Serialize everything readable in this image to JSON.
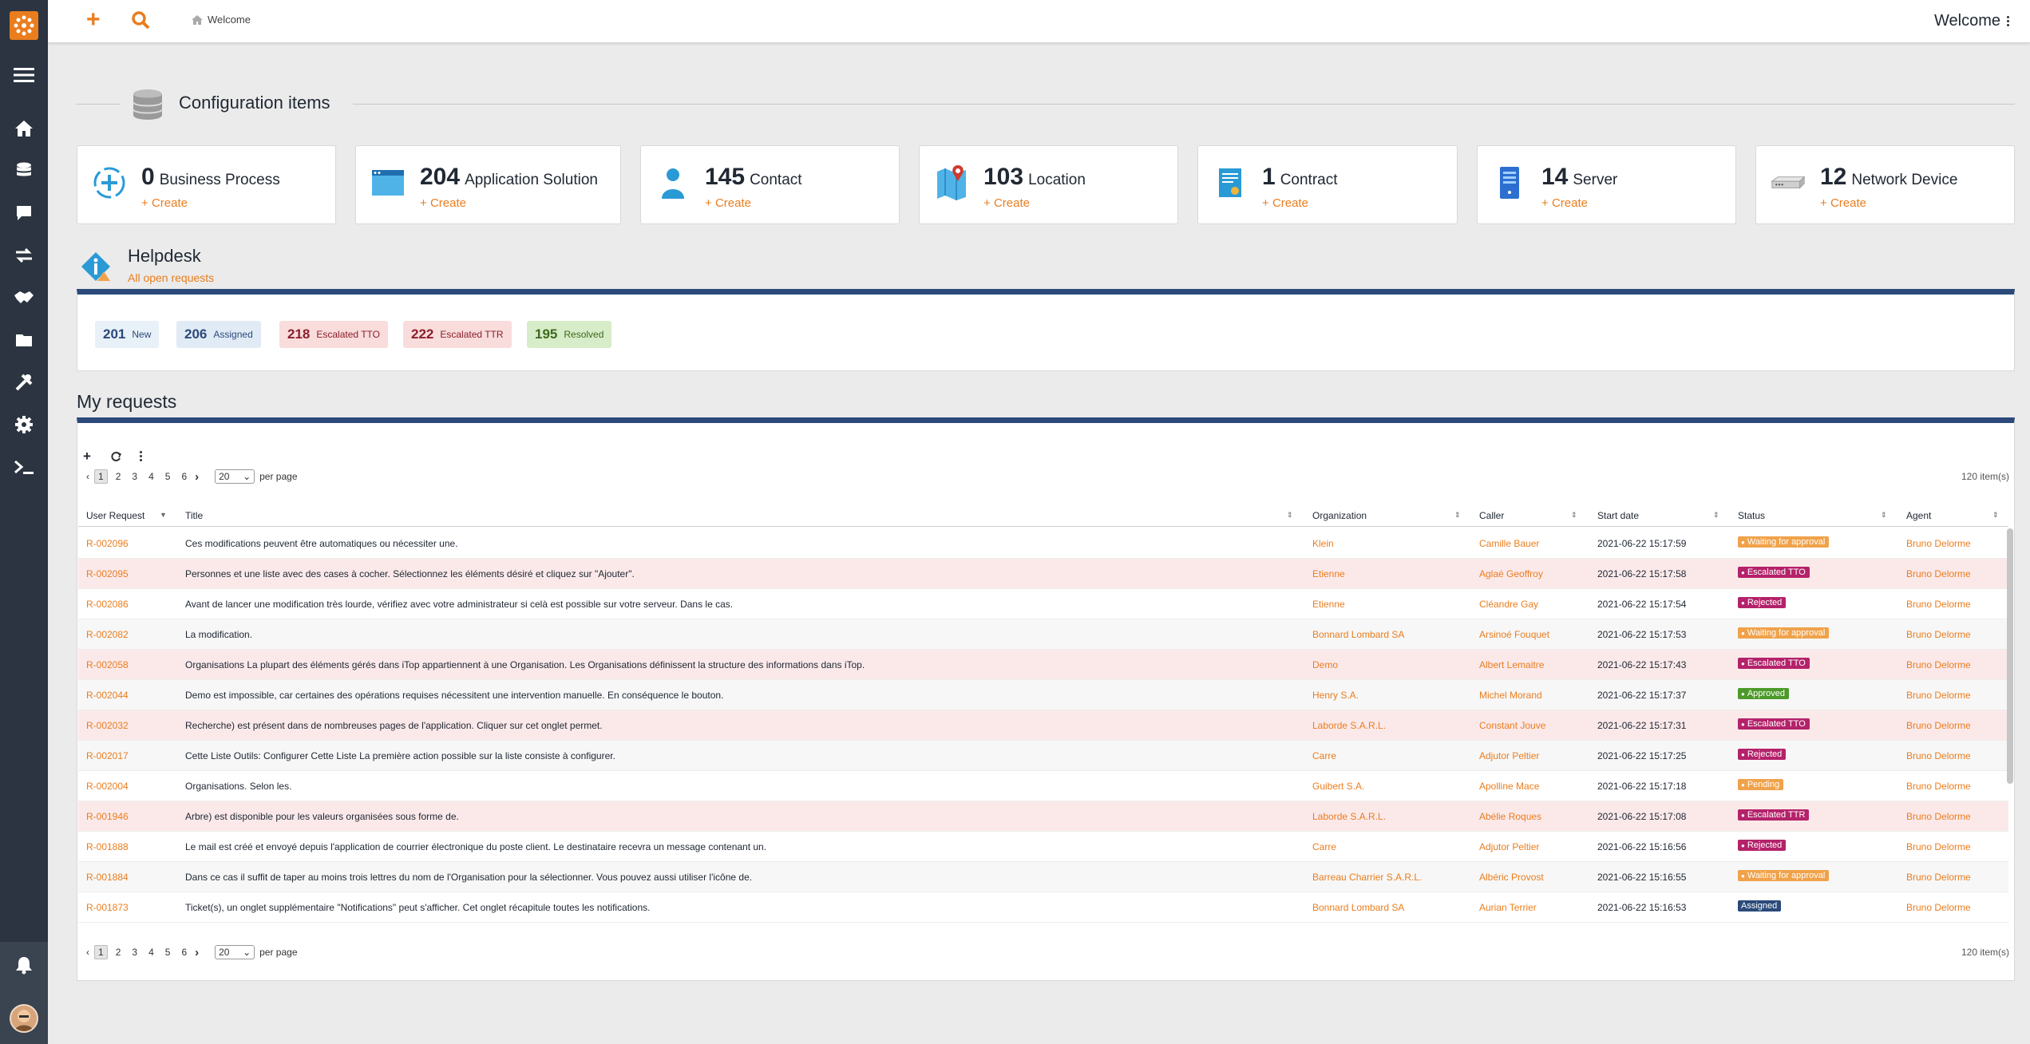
{
  "topbar": {
    "breadcrumb": "Welcome",
    "user_menu": "Welcome"
  },
  "section": {
    "title": "Configuration items"
  },
  "dashlets": [
    {
      "count": "0",
      "label": "Business Process",
      "create": "Create",
      "icon": "business-process-icon"
    },
    {
      "count": "204",
      "label": "Application Solution",
      "create": "Create",
      "icon": "application-solution-icon"
    },
    {
      "count": "145",
      "label": "Contact",
      "create": "Create",
      "icon": "contact-icon"
    },
    {
      "count": "103",
      "label": "Location",
      "create": "Create",
      "icon": "location-icon"
    },
    {
      "count": "1",
      "label": "Contract",
      "create": "Create",
      "icon": "contract-icon"
    },
    {
      "count": "14",
      "label": "Server",
      "create": "Create",
      "icon": "server-icon"
    },
    {
      "count": "12",
      "label": "Network Device",
      "create": "Create",
      "icon": "network-device-icon"
    }
  ],
  "helpdesk": {
    "title": "Helpdesk",
    "subtitle": "All open requests",
    "badges": [
      {
        "count": "201",
        "label": "New",
        "color": "#e8f0f8"
      },
      {
        "count": "206",
        "label": "Assigned",
        "color": "#e1ebf5"
      },
      {
        "count": "218",
        "label": "Escalated TTO",
        "color": "#f9dcdc"
      },
      {
        "count": "222",
        "label": "Escalated TTR",
        "color": "#f9dcdc"
      },
      {
        "count": "195",
        "label": "Resolved",
        "color": "#d7ecc8"
      }
    ]
  },
  "my_requests": {
    "title": "My requests",
    "pages": [
      "1",
      "2",
      "3",
      "4",
      "5",
      "6"
    ],
    "per_page_value": "20",
    "per_page_label": "per page",
    "item_count": "120 item(s)",
    "columns": [
      "User Request",
      "Title",
      "Organization",
      "Caller",
      "Start date",
      "Status",
      "Agent"
    ],
    "rows": [
      {
        "ref": "R-002096",
        "title": "Ces modifications peuvent être automatiques ou nécessiter une.",
        "org": "Klein",
        "caller": "Camille Bauer",
        "date": "2021-06-22 15:17:59",
        "status": "Waiting for approval",
        "agent": "Bruno Delorme"
      },
      {
        "ref": "R-002095",
        "title": "Personnes et une liste avec des cases à cocher. Sélectionnez les éléments désiré et cliquez sur \"Ajouter\".",
        "org": "Etienne",
        "caller": "Aglaé Geoffroy",
        "date": "2021-06-22 15:17:58",
        "status": "Escalated TTO",
        "agent": "Bruno Delorme"
      },
      {
        "ref": "R-002086",
        "title": "Avant de lancer une modification très lourde, vérifiez avec votre administrateur si celà est possible sur votre serveur. Dans le cas.",
        "org": "Etienne",
        "caller": "Cléandre Gay",
        "date": "2021-06-22 15:17:54",
        "status": "Rejected",
        "agent": "Bruno Delorme"
      },
      {
        "ref": "R-002082",
        "title": "La modification.",
        "org": "Bonnard Lombard SA",
        "caller": "Arsinoé Fouquet",
        "date": "2021-06-22 15:17:53",
        "status": "Waiting for approval",
        "agent": "Bruno Delorme"
      },
      {
        "ref": "R-002058",
        "title": "Organisations La plupart des éléments gérés dans iTop appartiennent à une Organisation. Les Organisations définissent la structure des informations dans iTop.",
        "org": "Demo",
        "caller": "Albert Lemaitre",
        "date": "2021-06-22 15:17:43",
        "status": "Escalated TTO",
        "agent": "Bruno Delorme"
      },
      {
        "ref": "R-002044",
        "title": "Demo est impossible, car certaines des opérations requises nécessitent une intervention manuelle. En conséquence le bouton.",
        "org": "Henry S.A.",
        "caller": "Michel Morand",
        "date": "2021-06-22 15:17:37",
        "status": "Approved",
        "agent": "Bruno Delorme"
      },
      {
        "ref": "R-002032",
        "title": "Recherche) est présent dans de nombreuses pages de l'application. Cliquer sur cet onglet permet.",
        "org": "Laborde S.A.R.L.",
        "caller": "Constant Jouve",
        "date": "2021-06-22 15:17:31",
        "status": "Escalated TTO",
        "agent": "Bruno Delorme"
      },
      {
        "ref": "R-002017",
        "title": "Cette Liste Outils: Configurer Cette Liste La première action possible sur la liste consiste à configurer.",
        "org": "Carre",
        "caller": "Adjutor Peltier",
        "date": "2021-06-22 15:17:25",
        "status": "Rejected",
        "agent": "Bruno Delorme"
      },
      {
        "ref": "R-002004",
        "title": "Organisations. Selon les.",
        "org": "Guibert S.A.",
        "caller": "Apolline Mace",
        "date": "2021-06-22 15:17:18",
        "status": "Pending",
        "agent": "Bruno Delorme"
      },
      {
        "ref": "R-001946",
        "title": "Arbre) est disponible pour les valeurs organisées sous forme de.",
        "org": "Laborde S.A.R.L.",
        "caller": "Abélie Roques",
        "date": "2021-06-22 15:17:08",
        "status": "Escalated TTR",
        "agent": "Bruno Delorme"
      },
      {
        "ref": "R-001888",
        "title": "Le mail est créé et envoyé depuis l'application de courrier électronique du poste client. Le destinataire recevra un message contenant un.",
        "org": "Carre",
        "caller": "Adjutor Peltier",
        "date": "2021-06-22 15:16:56",
        "status": "Rejected",
        "agent": "Bruno Delorme"
      },
      {
        "ref": "R-001884",
        "title": "Dans ce cas il suffit de taper au moins trois lettres du nom de l'Organisation pour la sélectionner. Vous pouvez aussi utiliser l'icône de.",
        "org": "Barreau Charrier S.A.R.L.",
        "caller": "Albéric Provost",
        "date": "2021-06-22 15:16:55",
        "status": "Waiting for approval",
        "agent": "Bruno Delorme"
      },
      {
        "ref": "R-001873",
        "title": "Ticket(s), un onglet supplémentaire \"Notifications\" peut s'afficher. Cet onglet récapitule toutes les notifications.",
        "org": "Bonnard Lombard SA",
        "caller": "Aurian Terrier",
        "date": "2021-06-22 15:16:53",
        "status": "Assigned",
        "agent": "Bruno Delorme"
      }
    ]
  },
  "colors": {
    "accent": "#ea7d1e",
    "sidebar": "#2b3440",
    "panel_bar": "#2b4a7a"
  }
}
